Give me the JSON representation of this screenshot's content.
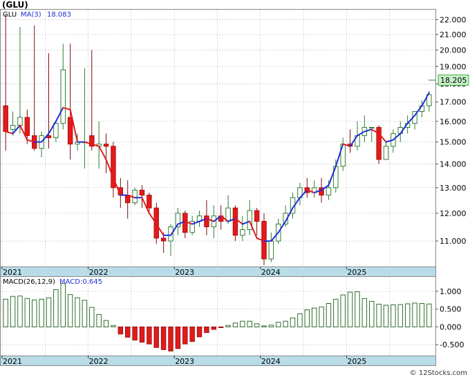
{
  "header": {
    "ticker": "(GLU)",
    "ma_legend_symbol": "GLU",
    "ma_legend_label": "MA(3)",
    "ma_legend_value": "18.083"
  },
  "macd_header": {
    "label": "MACD(26,12,9)",
    "value_label": "MACD:0.645"
  },
  "last_price_label": "18.205",
  "watermark": "© 12Stocks.com",
  "colors": {
    "up_candle": "#2e7d32",
    "down_candle": "#e31a1c",
    "ma_down": "#e31a1c",
    "ma_up": "#1f2fd6",
    "date_axis_band": "#b9dde8",
    "last_price_bg": "#c8f0c8",
    "grid": "#bbbbbb",
    "macd_positive": "#2e6b2e",
    "macd_negative": "#e31a1c"
  },
  "chart_data": [
    {
      "type": "candlestick",
      "title": "(GLU)",
      "period": "monthly",
      "year_labels": [
        "2021",
        "2022",
        "2023",
        "2024",
        "2025"
      ],
      "y_ticks": [
        "22.000",
        "21.000",
        "20.000",
        "19.000",
        "18.000",
        "17.000",
        "16.000",
        "15.000",
        "14.000",
        "13.000",
        "12.000",
        "11.000"
      ],
      "y_tick_values": [
        22,
        21,
        20,
        19,
        18,
        17,
        16,
        15,
        14,
        13,
        12,
        11
      ],
      "ylim": [
        10.2,
        22.6
      ],
      "log_scale": true,
      "grid": true,
      "last_price": 18.205,
      "x": [
        "2021-01",
        "2021-02",
        "2021-03",
        "2021-04",
        "2021-05",
        "2021-06",
        "2021-07",
        "2021-08",
        "2021-09",
        "2021-10",
        "2021-11",
        "2021-12",
        "2022-01",
        "2022-02",
        "2022-03",
        "2022-04",
        "2022-05",
        "2022-06",
        "2022-07",
        "2022-08",
        "2022-09",
        "2022-10",
        "2022-11",
        "2022-12",
        "2023-01",
        "2023-02",
        "2023-03",
        "2023-04",
        "2023-05",
        "2023-06",
        "2023-07",
        "2023-08",
        "2023-09",
        "2023-10",
        "2023-11",
        "2023-12",
        "2024-01",
        "2024-02",
        "2024-03",
        "2024-04",
        "2024-05",
        "2024-06",
        "2024-07",
        "2024-08",
        "2024-09",
        "2024-10",
        "2024-11",
        "2024-12",
        "2025-01",
        "2025-02",
        "2025-03",
        "2025-04",
        "2025-05",
        "2025-06",
        "2025-07",
        "2025-08",
        "2025-09",
        "2025-10",
        "2025-11",
        "2025-12"
      ],
      "open": [
        16.8,
        15.6,
        15.8,
        16.2,
        15.3,
        14.7,
        15.3,
        15.2,
        15.9,
        16.2,
        14.9,
        15.0,
        15.3,
        14.8,
        14.9,
        14.8,
        13.0,
        12.7,
        12.4,
        12.9,
        12.7,
        12.2,
        11.1,
        11.0,
        11.5,
        12.0,
        11.3,
        11.7,
        11.9,
        11.5,
        11.9,
        11.7,
        12.2,
        11.2,
        11.4,
        12.1,
        11.7,
        10.4,
        11.0,
        11.6,
        12.0,
        12.6,
        13.0,
        12.8,
        13.0,
        12.7,
        13.0,
        13.9,
        14.9,
        14.8,
        15.3,
        15.7,
        15.7,
        14.2,
        14.8,
        15.4,
        15.7,
        15.9,
        16.5,
        16.8
      ],
      "close": [
        15.5,
        15.8,
        16.2,
        15.3,
        14.7,
        15.3,
        15.2,
        15.9,
        18.8,
        14.9,
        15.0,
        15.0,
        14.8,
        14.9,
        14.8,
        13.0,
        12.7,
        12.4,
        12.9,
        12.7,
        12.2,
        11.1,
        11.0,
        11.5,
        12.0,
        11.3,
        11.7,
        11.9,
        11.5,
        11.9,
        11.7,
        12.2,
        11.2,
        11.4,
        12.1,
        11.7,
        10.4,
        11.0,
        11.6,
        12.0,
        12.6,
        13.0,
        12.8,
        13.0,
        12.7,
        13.0,
        13.9,
        14.9,
        14.8,
        15.3,
        15.7,
        15.7,
        14.2,
        14.8,
        15.4,
        15.7,
        15.9,
        16.5,
        16.8,
        17.4
      ],
      "high": [
        22.4,
        16.5,
        21.5,
        16.6,
        21.6,
        15.5,
        19.8,
        16.0,
        20.4,
        20.4,
        15.4,
        18.9,
        20.0,
        16.0,
        15.4,
        15.0,
        13.4,
        13.3,
        13.0,
        13.1,
        12.8,
        12.4,
        11.3,
        11.6,
        12.2,
        12.1,
        11.9,
        12.1,
        12.5,
        12.3,
        12.3,
        12.7,
        12.3,
        11.9,
        12.5,
        12.2,
        12.0,
        11.3,
        11.8,
        12.3,
        12.8,
        13.2,
        13.4,
        13.3,
        13.4,
        13.3,
        14.2,
        15.2,
        15.6,
        16.0,
        16.3,
        15.6,
        15.8,
        15.0,
        15.6,
        16.0,
        16.3,
        16.5,
        17.1,
        17.6
      ],
      "low": [
        14.6,
        15.3,
        15.4,
        14.9,
        14.6,
        14.3,
        14.7,
        15.0,
        15.6,
        14.2,
        14.6,
        13.8,
        14.6,
        13.8,
        13.6,
        12.6,
        12.2,
        11.8,
        12.3,
        12.2,
        12.0,
        10.9,
        10.6,
        10.5,
        11.2,
        11.1,
        11.2,
        11.5,
        11.2,
        11.1,
        11.4,
        11.6,
        11.0,
        11.0,
        11.2,
        11.2,
        10.2,
        10.3,
        10.9,
        11.5,
        11.8,
        12.3,
        12.6,
        12.6,
        12.4,
        12.5,
        12.8,
        13.7,
        14.5,
        14.6,
        15.0,
        15.0,
        14.0,
        14.6,
        14.5,
        15.0,
        15.4,
        15.6,
        16.2,
        16.5
      ],
      "ma3": [
        15.5,
        15.4,
        15.8,
        15.1,
        15.0,
        15.0,
        15.4,
        16.0,
        16.7,
        16.6,
        15.0,
        15.0,
        14.9,
        14.8,
        14.2,
        13.4,
        12.7,
        12.7,
        12.6,
        12.6,
        12.0,
        11.6,
        11.2,
        11.2,
        11.6,
        11.7,
        11.6,
        11.7,
        11.8,
        11.7,
        11.9,
        11.7,
        11.8,
        11.6,
        11.7,
        11.1,
        11.0,
        11.0,
        11.3,
        11.7,
        12.2,
        12.6,
        12.9,
        12.8,
        12.9,
        13.1,
        13.9,
        14.9,
        14.8,
        15.3,
        15.5,
        15.6,
        15.4,
        15.0,
        15.1,
        15.4,
        15.9,
        16.3,
        16.8,
        17.5
      ]
    },
    {
      "type": "bar",
      "title": "MACD(26,12,9)",
      "series_label": "MACD:0.645",
      "y_ticks": [
        "1.000",
        "0.500",
        "0.000",
        "-0.500"
      ],
      "y_tick_values": [
        1.0,
        0.5,
        0.0,
        -0.5
      ],
      "ylim": [
        -0.75,
        1.35
      ],
      "year_labels": [
        "2021",
        "2022",
        "2023",
        "2024",
        "2025"
      ],
      "values": [
        0.78,
        0.86,
        0.87,
        0.8,
        0.76,
        0.78,
        0.82,
        1.05,
        1.22,
        0.91,
        0.82,
        0.75,
        0.55,
        0.35,
        0.18,
        0.04,
        -0.2,
        -0.29,
        -0.37,
        -0.43,
        -0.48,
        -0.58,
        -0.64,
        -0.68,
        -0.61,
        -0.48,
        -0.41,
        -0.28,
        -0.16,
        -0.07,
        -0.02,
        0.04,
        0.11,
        0.16,
        0.16,
        0.09,
        0.03,
        0.05,
        0.13,
        0.16,
        0.25,
        0.37,
        0.48,
        0.53,
        0.56,
        0.66,
        0.78,
        0.9,
        0.98,
        0.99,
        0.8,
        0.72,
        0.64,
        0.61,
        0.62,
        0.63,
        0.65,
        0.67,
        0.66,
        0.645
      ]
    }
  ]
}
